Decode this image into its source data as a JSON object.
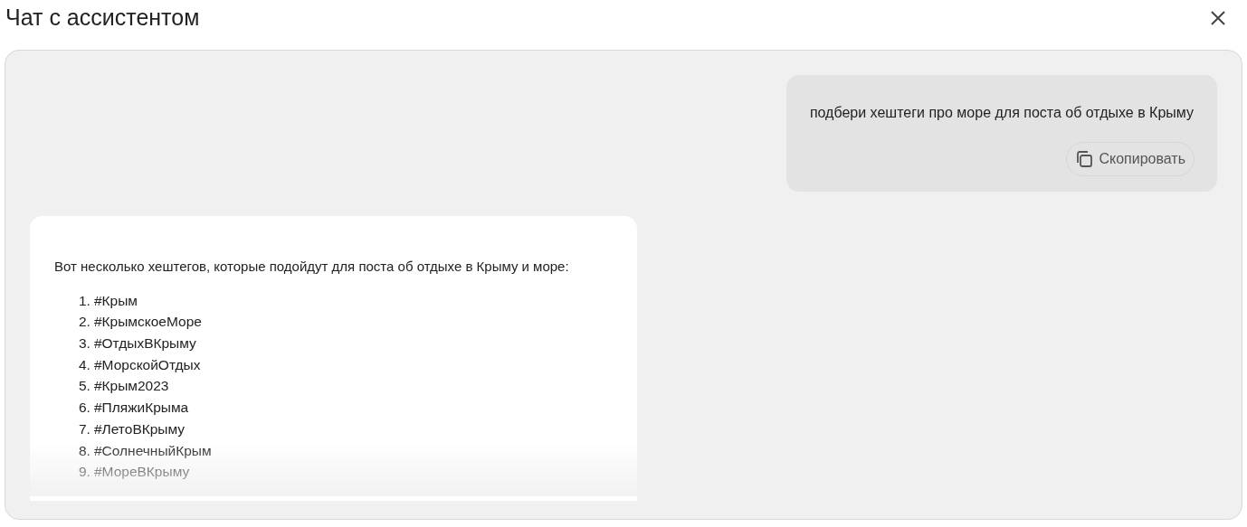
{
  "dialog": {
    "title": "Чат с ассистентом"
  },
  "messages": [
    {
      "kind": "user",
      "text": "подбери хештеги про море для поста об отдыхе в Крыму",
      "copy_button": "Скопировать"
    },
    {
      "kind": "assistant",
      "intro": "Вот несколько хештегов, которые подойдут для поста об отдыхе в Крыму и море:",
      "items": [
        {
          "number": "1.",
          "tag": "#Крым"
        },
        {
          "number": "2.",
          "tag": "#КрымскоеМоре"
        },
        {
          "number": "3.",
          "tag": "#ОтдыхВКрыму"
        },
        {
          "number": "4.",
          "tag": "#МорскойОтдых"
        },
        {
          "number": "5.",
          "tag": "#Крым2023"
        },
        {
          "number": "6.",
          "tag": "#ПляжиКрыма"
        },
        {
          "number": "7.",
          "tag": "#ЛетоВКрыму"
        },
        {
          "number": "8.",
          "tag": "#СолнечныйКрым"
        },
        {
          "number": "9.",
          "tag": "#МореВКрыму"
        }
      ]
    }
  ]
}
